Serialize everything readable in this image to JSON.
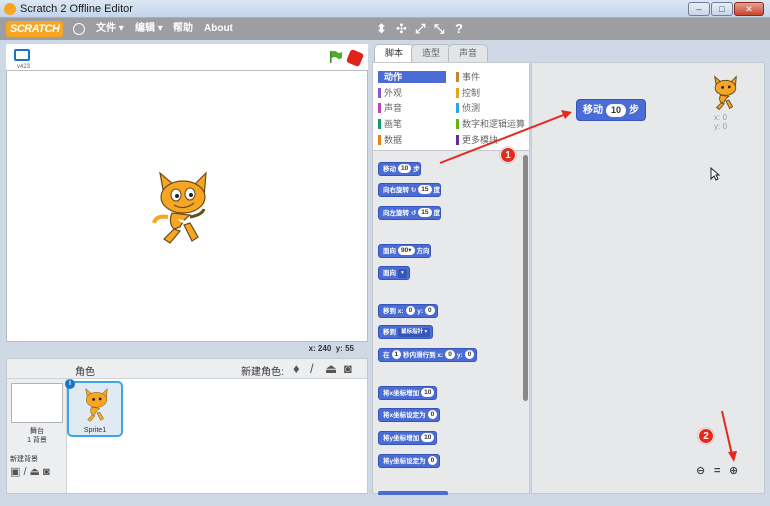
{
  "window": {
    "title": "Scratch 2 Offline Editor",
    "min": "–",
    "max": "□",
    "close": "✕"
  },
  "menubar": {
    "logo": "SCRATCH",
    "file": "文件 ▾",
    "edit": "编辑 ▾",
    "help": "帮助",
    "about": "About",
    "tools": [
      "⬍",
      "✣",
      "⤢",
      "⤡",
      "?"
    ]
  },
  "stage": {
    "version": "v423",
    "coords_x_label": "x:",
    "coords_x": "240",
    "coords_y_label": "y:",
    "coords_y": "55"
  },
  "sprites": {
    "header": "角色",
    "new_sprite": "新建角色:",
    "stage_name": "舞台",
    "stage_backdrops": "1 背景",
    "new_backdrop": "新建背景",
    "sprite_name": "Sprite1",
    "info": "i"
  },
  "tabs": [
    "脚本",
    "造型",
    "声音"
  ],
  "categories": [
    {
      "label": "动作",
      "color": "#4a6cd4"
    },
    {
      "label": "外观",
      "color": "#8a55d7"
    },
    {
      "label": "声音",
      "color": "#bb42c3"
    },
    {
      "label": "画笔",
      "color": "#0e9a6c"
    },
    {
      "label": "数据",
      "color": "#ee7d16"
    },
    {
      "label": "事件",
      "color": "#c88330"
    },
    {
      "label": "控制",
      "color": "#e1a91a"
    },
    {
      "label": "侦测",
      "color": "#2ca5e2"
    },
    {
      "label": "数字和逻辑运算",
      "color": "#5cb712"
    },
    {
      "label": "更多模块",
      "color": "#632d99"
    }
  ],
  "blocks": {
    "move": {
      "text": "移动",
      "value": "10",
      "suffix": "步"
    },
    "turn_right": {
      "text": "向右旋转",
      "arrow": "↻",
      "value": "15",
      "suffix": "度"
    },
    "turn_left": {
      "text": "向左旋转",
      "arrow": "↺",
      "value": "15",
      "suffix": "度"
    },
    "point_dir": {
      "text": "面向",
      "value": "90▾",
      "suffix": "方向"
    },
    "point_towards": {
      "text": "面向",
      "drop": "▾"
    },
    "goto_xy": {
      "text": "移到 x:",
      "x": "0",
      "y_label": "y:",
      "y": "0"
    },
    "goto": {
      "text": "移到",
      "drop": "鼠标指针 ▾"
    },
    "glide": {
      "text": "在",
      "secs": "1",
      "mid": "秒内滑行到 x:",
      "x": "0",
      "y_label": "y:",
      "y": "0"
    },
    "change_x": {
      "text": "将x坐标增加",
      "value": "10"
    },
    "set_x": {
      "text": "将x坐标设定为",
      "value": "0"
    },
    "change_y": {
      "text": "将y坐标增加",
      "value": "10"
    },
    "set_y": {
      "text": "将y坐标设定为",
      "value": "0"
    }
  },
  "scripts": {
    "block": {
      "text": "移动",
      "value": "10",
      "suffix": "步"
    },
    "sprite_x": "x: 0",
    "sprite_y": "y: 0",
    "zoom_out": "🔍−",
    "zoom_reset": "=",
    "zoom_in": "🔍+"
  },
  "annotations": {
    "marker1": "1",
    "marker2": "2",
    "color": "#e42a1d"
  }
}
